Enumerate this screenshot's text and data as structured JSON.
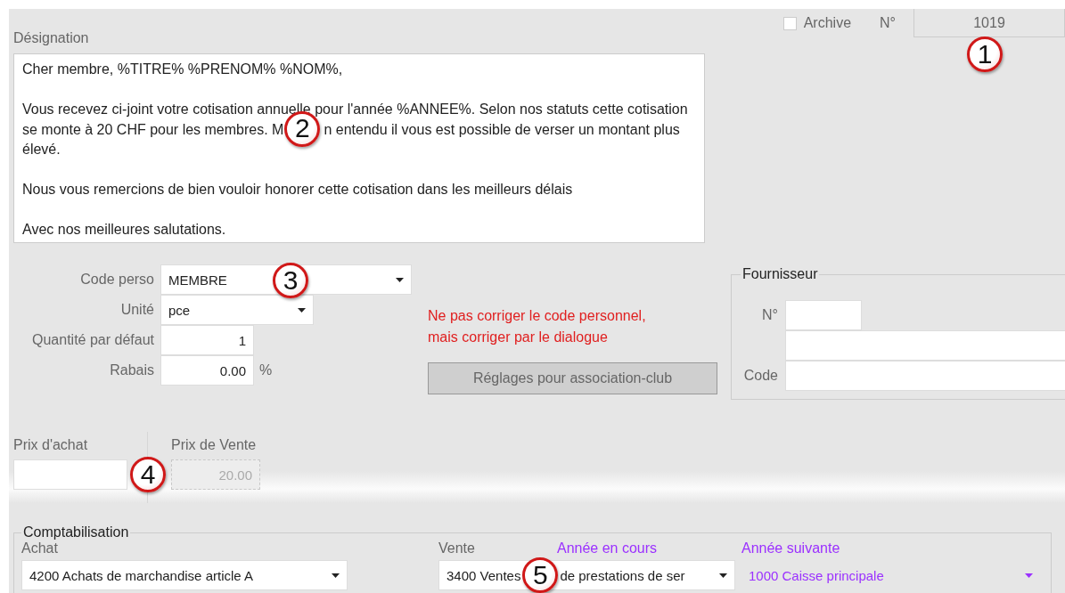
{
  "header": {
    "archive": {
      "label": "Archive",
      "checked": false
    },
    "number_label": "N°",
    "number": "1019",
    "callout": "1"
  },
  "designation": {
    "label": "Désignation",
    "paragraphs": [
      [
        {
          "segments": [
            "Cher membre, %TITRE% %PRENOM% %NOM%,"
          ]
        }
      ],
      [
        {
          "segments": [
            "Vous recevez ci-joint votre cotisation annuelle pour l'année %ANNEE%. Selon nos statuts cette cotisation"
          ]
        },
        {
          "segments": [
            "se monte à 20 CHF pour les membres. M",
            "n entendu il vous est possible de verser un montant plus"
          ],
          "callout": "2"
        },
        {
          "segments": [
            "élevé."
          ]
        }
      ],
      [
        {
          "segments": [
            "Nous vous remercions de bien vouloir  honorer cette cotisation dans les meilleurs délais"
          ]
        }
      ],
      [
        {
          "segments": [
            "Avec nos meilleures salutations."
          ]
        }
      ]
    ]
  },
  "fields": [
    {
      "label": "Code perso",
      "value": "MEMBRE",
      "kind": "combo",
      "callout": "3"
    },
    {
      "label": "Unité",
      "value": "pce",
      "kind": "combo"
    },
    {
      "label": "Quantité par défaut",
      "value": "1",
      "kind": "number"
    },
    {
      "label": "Rabais",
      "value": "0.00",
      "kind": "number",
      "suffix": "%"
    }
  ],
  "warning": [
    "Ne pas corriger le code personnel,",
    "mais corriger par le dialogue"
  ],
  "settings_button": "Réglages pour association-club",
  "supplier": {
    "title": "Fournisseur",
    "number_label": "N°",
    "code_label": "Code"
  },
  "prices": [
    {
      "label": "Prix d'achat",
      "disabled": false
    },
    {
      "label": "Prix de Vente",
      "value": "20.00",
      "disabled": true,
      "callout": "4"
    }
  ],
  "accounting": {
    "title": "Comptabilisation",
    "purchase": {
      "label": "Achat",
      "value": "4200 Achats de marchandise article A"
    },
    "sale": {
      "label": "Vente",
      "segments": [
        "3400 Ventes",
        "de prestations de ser"
      ],
      "callout": "5"
    },
    "current_year_label": "Année en cours",
    "next_year": {
      "label": "Année suivante",
      "value": "1000 Caisse  principale"
    }
  }
}
